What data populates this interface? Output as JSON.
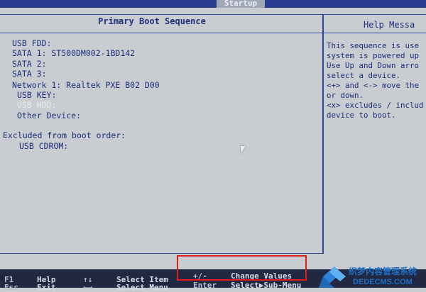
{
  "header": {
    "tab_label": "Startup"
  },
  "main": {
    "title": "Primary Boot Sequence",
    "boot_items": [
      "USB FDD:",
      "SATA 1: ST500DM002-1BD142",
      "SATA 2:",
      "SATA 3:",
      "Network 1: Realtek PXE B02 D00",
      "USB KEY:",
      "USB HDD:",
      "Other Device:"
    ],
    "excluded_title": "Excluded from boot order:",
    "excluded_items": [
      "USB CDROM:"
    ]
  },
  "help": {
    "title": "Help Messa",
    "lines": [
      "This sequence is use",
      "system is powered up",
      "Use Up and Down arro",
      "select a device.",
      "<+> and <-> move the",
      "or down.",
      "<x> excludes / includ",
      "device to boot."
    ]
  },
  "footer": {
    "keys": [
      {
        "key": "F1",
        "desc": "Help"
      },
      {
        "key": "Esc",
        "desc": "Exit"
      },
      {
        "key": "↑↓",
        "desc": "Select Item"
      },
      {
        "key": "←→",
        "desc": "Select Menu"
      },
      {
        "key": "+/-",
        "desc": "Change Values"
      },
      {
        "key": "Enter",
        "desc": "Select▶Sub-Menu"
      }
    ]
  },
  "watermark": {
    "line1": "织梦内容管理系统",
    "line2": "DEDECMS.COM"
  },
  "colors": {
    "highlight": "#e01d1d",
    "text": "#1b2f7a"
  }
}
